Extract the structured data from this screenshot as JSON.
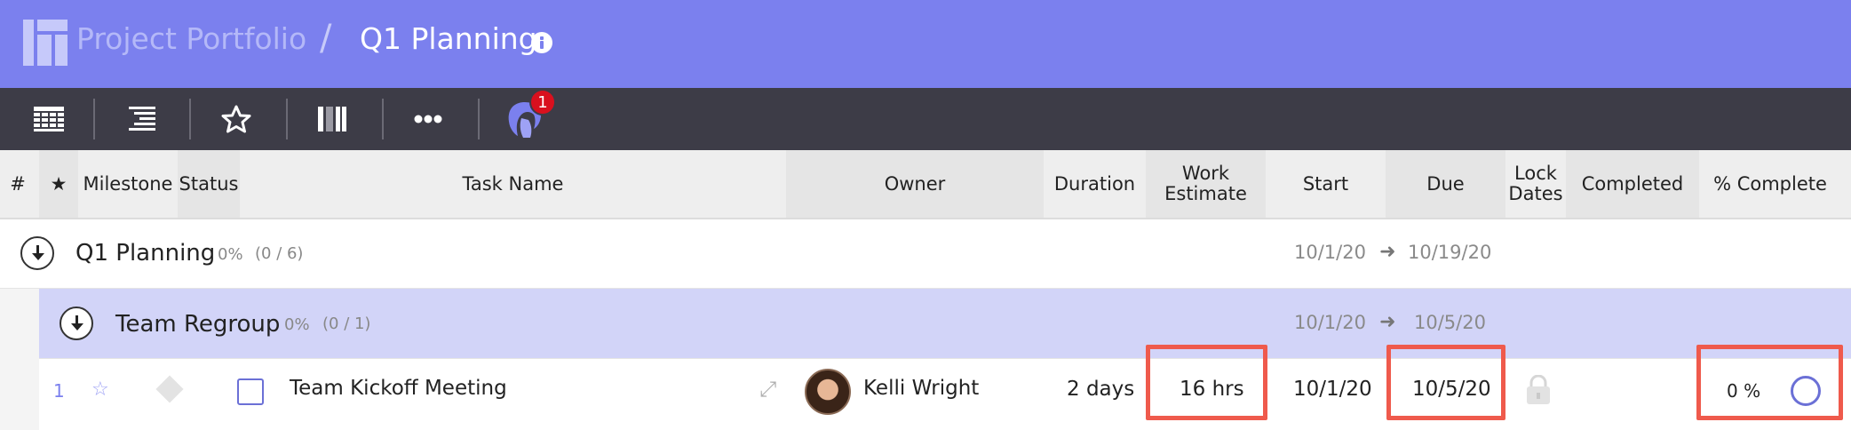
{
  "header": {
    "parent_title": "Project Portfolio",
    "separator": "/",
    "current_title": "Q1 Planning"
  },
  "toolbar": {
    "buttons": [
      "grid-view-icon",
      "indent-list-icon",
      "star-icon",
      "columns-icon",
      "more-icon",
      "notifications-icon"
    ],
    "notification_count": "1"
  },
  "columns": {
    "row_number": "#",
    "star": "★",
    "milestone": "Milestone",
    "status": "Status",
    "task_name": "Task Name",
    "owner": "Owner",
    "duration": "Duration",
    "work_estimate_line1": "Work",
    "work_estimate_line2": "Estimate",
    "start": "Start",
    "due": "Due",
    "lock_dates_line1": "Lock",
    "lock_dates_line2": "Dates",
    "completed": "Completed",
    "percent_complete": "% Complete"
  },
  "project": {
    "name": "Q1 Planning",
    "percent": "0%",
    "count": "(0 / 6)",
    "start": "10/1/20",
    "arrow": "➜",
    "due": "10/19/20"
  },
  "group": {
    "name": "Team Regroup",
    "percent": "0%",
    "count": "(0 / 1)",
    "start": "10/1/20",
    "arrow": "➜",
    "due": "10/5/20"
  },
  "task": {
    "row_number": "1",
    "star": "☆",
    "name": "Team Kickoff Meeting",
    "expand": "⤢",
    "owner": "Kelli Wright",
    "duration": "2 days",
    "work_estimate": "16 hrs",
    "start": "10/1/20",
    "due": "10/5/20",
    "percent_complete": "0 %",
    "progress": 0
  },
  "colors": {
    "header_bg": "#7b80ee",
    "toolbar_bg": "#3d3c47",
    "group_bg": "#d2d4f8",
    "highlight": "#ef5a4c",
    "accent": "#6b70d6",
    "badge": "#d9101e"
  }
}
